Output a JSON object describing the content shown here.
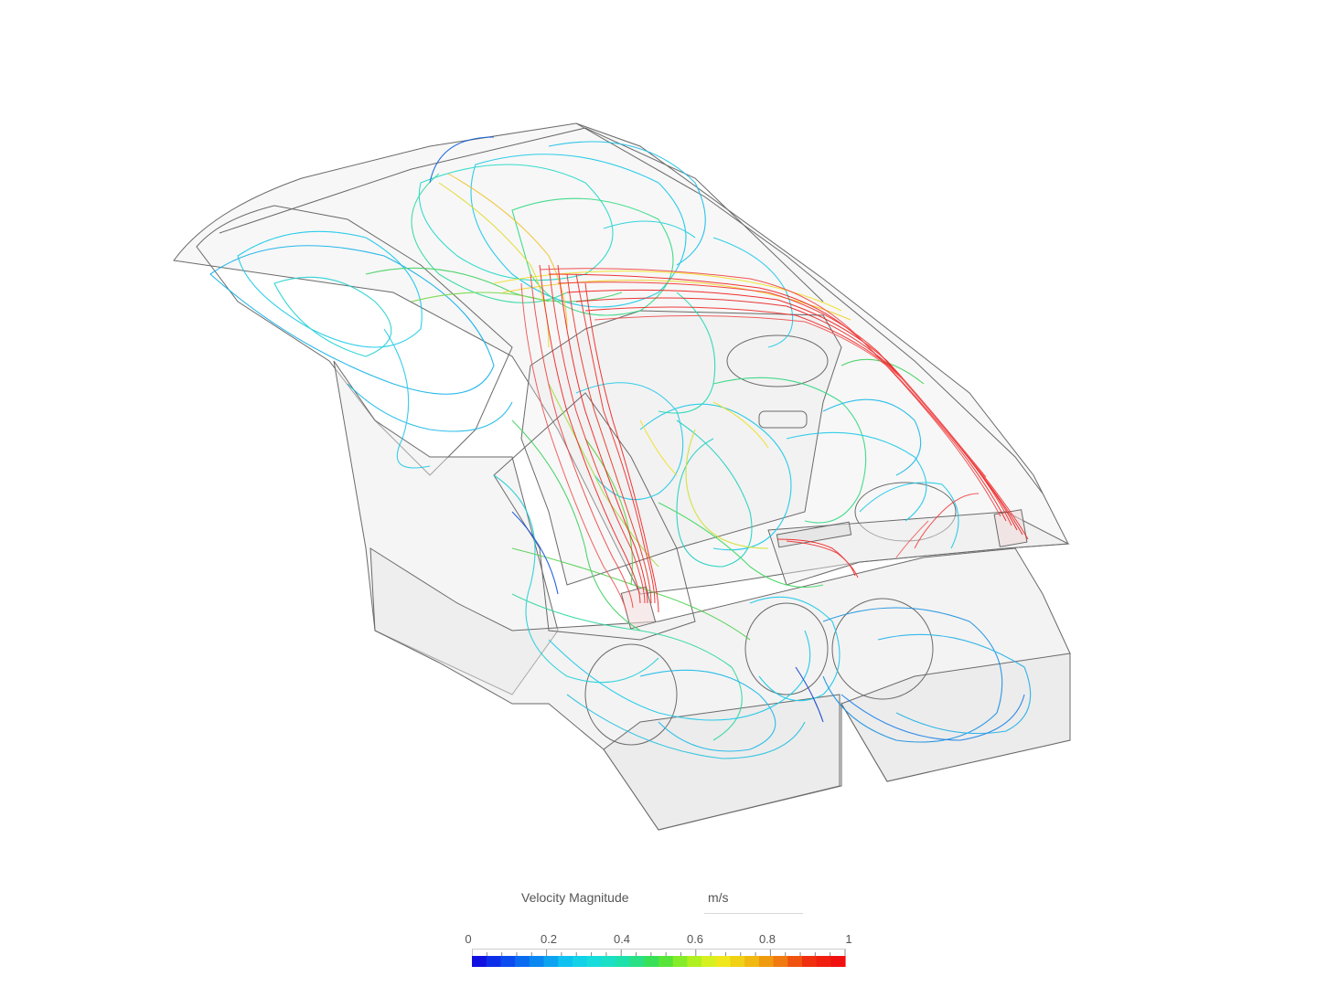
{
  "legend": {
    "title": "Velocity Magnitude",
    "unit": "m/s",
    "ticks": [
      "0",
      "0.2",
      "0.4",
      "0.6",
      "0.8",
      "1"
    ],
    "tick_values": [
      0,
      0.2,
      0.4,
      0.6,
      0.8,
      1
    ],
    "range": [
      0,
      1
    ],
    "colormap": [
      "#1010e0",
      "#0a4ff0",
      "#0a8cf0",
      "#10c8f0",
      "#18e0d8",
      "#20e0a0",
      "#40e040",
      "#a0f020",
      "#f0f020",
      "#f0c010",
      "#f08010",
      "#f03010",
      "#f01010"
    ]
  },
  "colors": {
    "geometry_stroke": "#666666",
    "geometry_fill": "#e6e6e6",
    "background": "#ffffff"
  }
}
